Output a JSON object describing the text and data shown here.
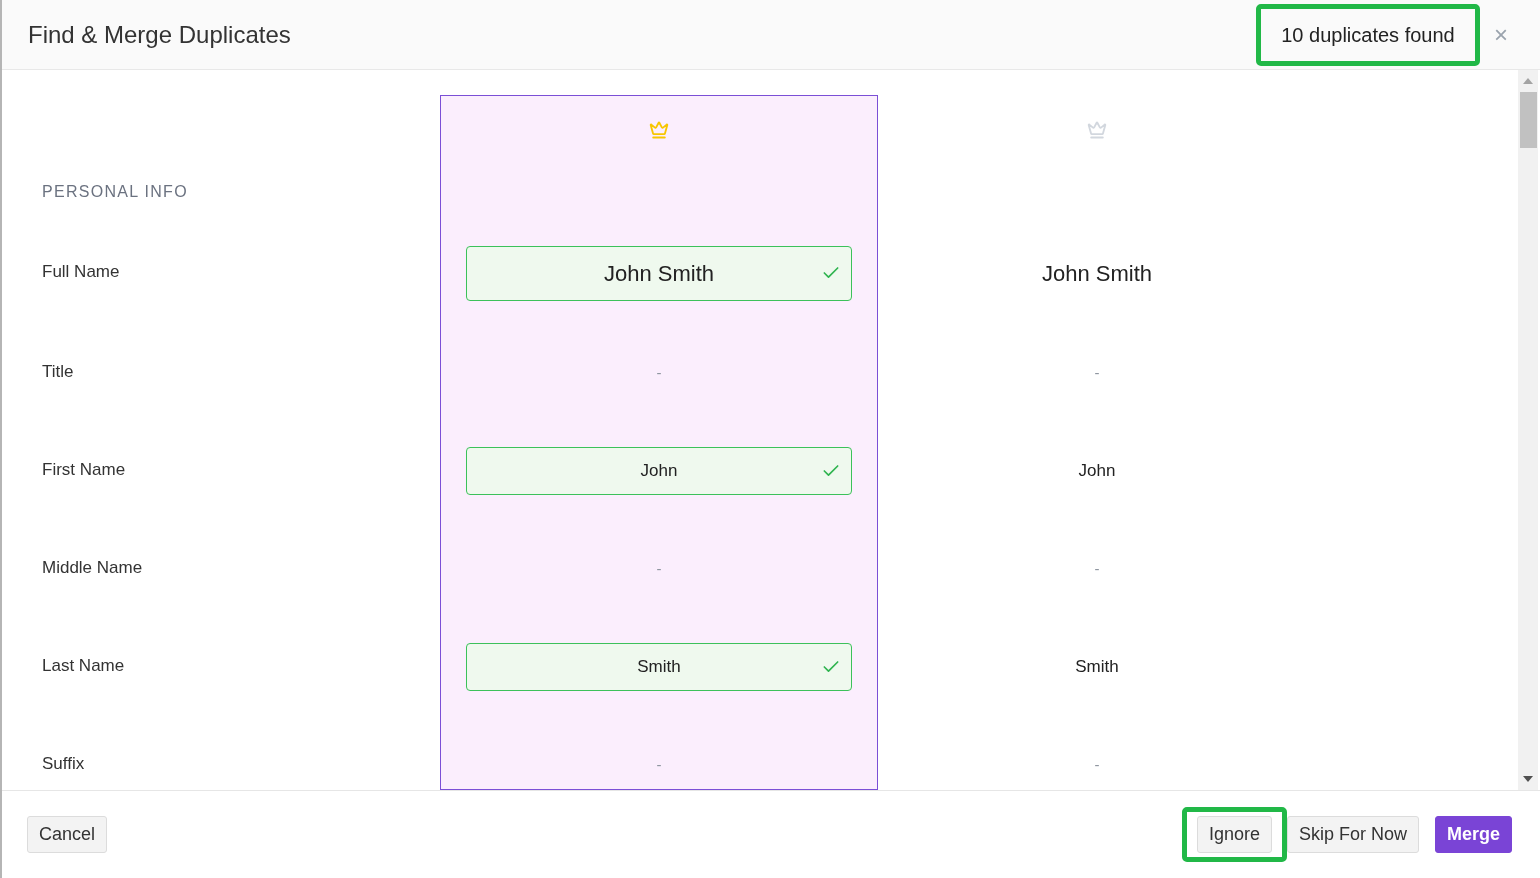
{
  "dialog": {
    "title": "Find & Merge Duplicates",
    "duplicates": {
      "text": "10 duplicates found",
      "highlighted": true
    },
    "close": "×"
  },
  "records": [
    {
      "master": true
    },
    {
      "master": false
    }
  ],
  "section": "PERSONAL INFO",
  "fields": [
    {
      "label": "Full Name",
      "kind": "name",
      "values": [
        {
          "text": "John Smith",
          "chosen": true,
          "muted": false
        },
        {
          "text": "John Smith",
          "chosen": false,
          "muted": false
        }
      ]
    },
    {
      "label": "Title",
      "kind": "field",
      "values": [
        {
          "text": "-",
          "chosen": false,
          "muted": true
        },
        {
          "text": "-",
          "chosen": false,
          "muted": true
        }
      ]
    },
    {
      "label": "First Name",
      "kind": "field",
      "values": [
        {
          "text": "John",
          "chosen": true,
          "muted": false
        },
        {
          "text": "John",
          "chosen": false,
          "muted": false
        }
      ]
    },
    {
      "label": "Middle Name",
      "kind": "field",
      "values": [
        {
          "text": "-",
          "chosen": false,
          "muted": true
        },
        {
          "text": "-",
          "chosen": false,
          "muted": true
        }
      ]
    },
    {
      "label": "Last Name",
      "kind": "field",
      "values": [
        {
          "text": "Smith",
          "chosen": true,
          "muted": false
        },
        {
          "text": "Smith",
          "chosen": false,
          "muted": false
        }
      ]
    },
    {
      "label": "Suffix",
      "kind": "field",
      "values": [
        {
          "text": "-",
          "chosen": false,
          "muted": true
        },
        {
          "text": "-",
          "chosen": false,
          "muted": true
        }
      ]
    }
  ],
  "footer": {
    "left": [
      {
        "label": "Cancel",
        "kind": "secondary",
        "highlighted": false
      }
    ],
    "right": [
      {
        "label": "Ignore",
        "kind": "secondary",
        "highlighted": true
      },
      {
        "label": "Skip For Now",
        "kind": "secondary",
        "highlighted": false
      },
      {
        "label": "Merge",
        "kind": "primary",
        "highlighted": false
      }
    ]
  }
}
